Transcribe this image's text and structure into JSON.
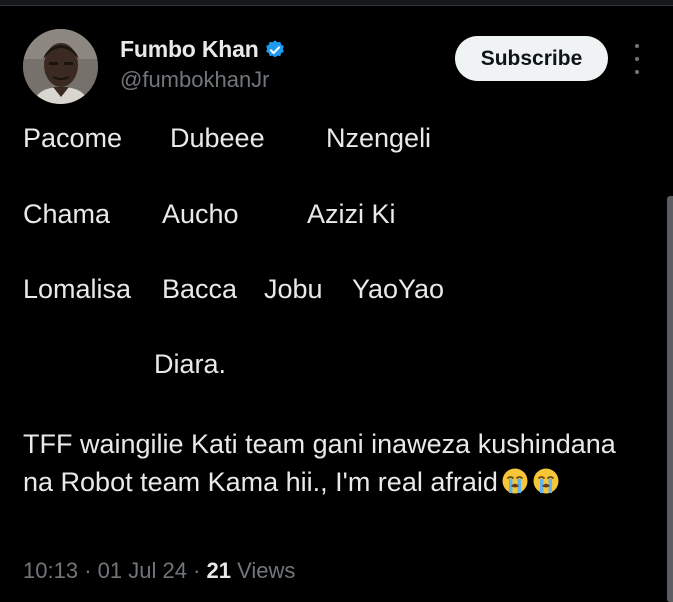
{
  "author": {
    "display_name": "Fumbo Khan",
    "handle": "@fumbokhanJr",
    "verified": true,
    "avatar": "profile-photo"
  },
  "actions": {
    "subscribe_label": "Subscribe",
    "more_icon": "vertical-ellipsis-icon"
  },
  "tweet": {
    "row1": [
      "Pacome",
      "Dubeee",
      "Nzengeli"
    ],
    "row2": [
      "Chama",
      "Aucho",
      "Azizi Ki"
    ],
    "row3": [
      "Lomalisa",
      "Bacca",
      "Jobu",
      "YaoYao"
    ],
    "row4": [
      "Diara."
    ],
    "paragraph": "TFF waingilie Kati team gani inaweza kushindana na Robot team Kama hii., I'm real afraid",
    "emojis": [
      "loudly-crying-face",
      "loudly-crying-face"
    ]
  },
  "meta": {
    "time": "10:13",
    "date": "01 Jul 24",
    "separator": "·",
    "views_count": "21",
    "views_label": "Views"
  },
  "colors": {
    "background": "#000000",
    "text": "#e7e9ea",
    "secondary": "#71767b",
    "verified": "#1d9bf0",
    "button_bg": "#eff3f4"
  }
}
